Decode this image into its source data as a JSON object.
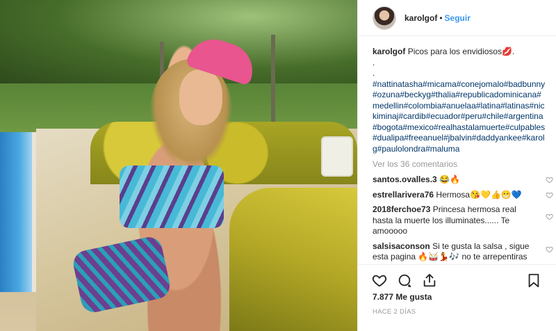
{
  "header": {
    "username": "karolgof",
    "separator": "•",
    "follow_label": "Seguir"
  },
  "caption": {
    "username": "karolgof",
    "text": "Picos para los envidiosos💋.",
    "dot1": ".",
    "dot2": ".",
    "hashtags": "#nattinatasha#micama#conejomalo#badbunny#ozuna#beckyg#thalia#republicadominicana#medellin#colombia#anuelaa#latina#latinas#nickiminaj#cardib#ecuador#peru#chile#argentina#bogota#mexico#realhastalamuerte#culpables#dualipa#freeanuel#jbalvin#daddyankee#karolg#paulolondra#maluma"
  },
  "view_all_comments": "Ver los 36 comentarios",
  "comments": [
    {
      "username": "santos.ovalles.3",
      "text": "😂🔥"
    },
    {
      "username": "estrellarivera76",
      "text": "Hermosa😘💛👍😁💙"
    },
    {
      "username": "2018ferchoe73",
      "text": "Princesa hermosa real hasta la muerte los illuminates...... Te amooooo"
    },
    {
      "username": "salsisaconson",
      "text": "Si te gusta la salsa , sigue esta pagina 🔥🥁💃🎶 no te arrepentiras"
    }
  ],
  "likes": "7.877 Me gusta",
  "timestamp": "HACE 2 DÍAS",
  "icons": {
    "heart": "heart-icon",
    "comment": "comment-icon",
    "share": "share-icon",
    "save": "bookmark-icon"
  },
  "colors": {
    "link_blue": "#3897f0",
    "hashtag": "#003569",
    "muted": "#999999"
  }
}
